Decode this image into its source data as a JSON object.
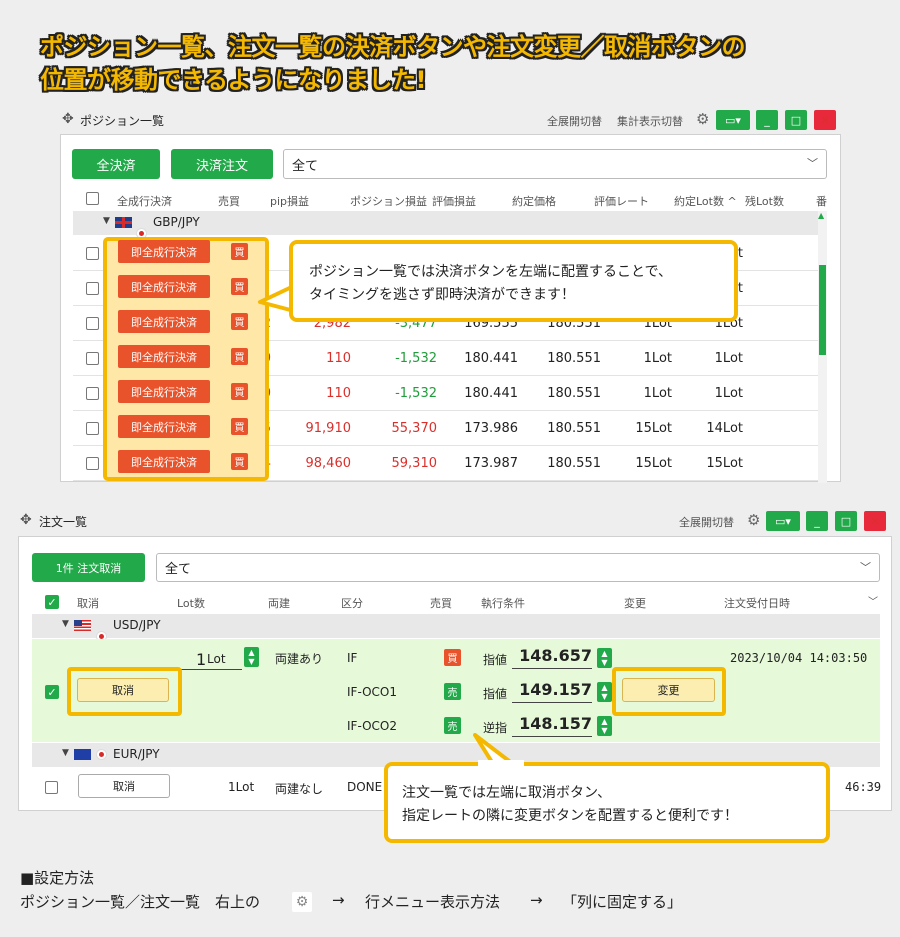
{
  "headline": {
    "line1": "ポジション一覧、注文一覧の決済ボタンや注文変更／取消ボタンの",
    "line2": "位置が移動できるようになりました!"
  },
  "position_panel": {
    "title": "ポジション一覧",
    "toolbar": {
      "expand": "全展開切替",
      "summary": "集計表示切替"
    },
    "buttons": {
      "close_all": "全決済",
      "close_order": "決済注文"
    },
    "filter": "全て",
    "headers": [
      "全成行決済",
      "売買",
      "pip損益",
      "ポジション損益",
      "評価損益",
      "約定価格",
      "評価レート",
      "約定Lot数 ^",
      "残Lot数",
      "番"
    ],
    "group": "GBP/JPY",
    "rows": [
      {
        "action": "即全成行決済",
        "side": "買",
        "pip": "",
        "pnl": "",
        "eval": "",
        "price": "",
        "rate": "",
        "lot": "",
        "remain": "1Lot"
      },
      {
        "action": "即全成行決済",
        "side": "買",
        "pip": "",
        "pnl": "",
        "eval": "",
        "price": "",
        "rate": "",
        "lot": "",
        "remain": "1Lot"
      },
      {
        "action": "即全成行決済",
        "side": "買",
        "pip": "2,982",
        "pnl": "2,982",
        "eval": "-3,477",
        "price": "169.555",
        "rate": "180.551",
        "lot": "1Lot",
        "remain": "1Lot"
      },
      {
        "action": "即全成行決済",
        "side": "買",
        "pip": "110",
        "pnl": "110",
        "eval": "-1,532",
        "price": "180.441",
        "rate": "180.551",
        "lot": "1Lot",
        "remain": "1Lot"
      },
      {
        "action": "即全成行決済",
        "side": "買",
        "pip": "110",
        "pnl": "110",
        "eval": "-1,532",
        "price": "180.441",
        "rate": "180.551",
        "lot": "1Lot",
        "remain": "1Lot"
      },
      {
        "action": "即全成行決済",
        "side": "買",
        "pip": "6,565",
        "pnl": "91,910",
        "eval": "55,370",
        "price": "173.986",
        "rate": "180.551",
        "lot": "15Lot",
        "remain": "14Lot"
      },
      {
        "action": "即全成行決済",
        "side": "買",
        "pip": "6,564",
        "pnl": "98,460",
        "eval": "59,310",
        "price": "173.987",
        "rate": "180.551",
        "lot": "15Lot",
        "remain": "15Lot"
      }
    ],
    "callout": {
      "line1": "ポジション一覧では決済ボタンを左端に配置することで、",
      "line2": "タイミングを逃さず即時決済ができます！"
    }
  },
  "order_panel": {
    "title": "注文一覧",
    "toolbar": {
      "expand": "全展開切替"
    },
    "buttons": {
      "cancel_selected": "1件 注文取消"
    },
    "filter": "全て",
    "headers": [
      "取消",
      "Lot数",
      "両建",
      "区分",
      "売買",
      "執行条件",
      "変更",
      "注文受付日時"
    ],
    "group1": "USD/JPY",
    "order": {
      "cancel": "取消",
      "lot_value": "1",
      "lot_unit": "Lot",
      "hedge": "両建あり",
      "change": "変更",
      "datetime": "2023/10/04 14:03:50",
      "legs": [
        {
          "type": "IF",
          "side": "買",
          "cond": "指値",
          "price": "148.657"
        },
        {
          "type": "IF-OCO1",
          "side": "売",
          "cond": "指値",
          "price": "149.157"
        },
        {
          "type": "IF-OCO2",
          "side": "売",
          "cond": "逆指",
          "price": "148.157"
        }
      ]
    },
    "group2": "EUR/JPY",
    "order2": {
      "cancel": "取消",
      "lot": "1Lot",
      "hedge": "両建なし",
      "type": "DONE",
      "datetime_tail": "46:39"
    },
    "callout": {
      "line1": "注文一覧では左端に取消ボタン、",
      "line2": "指定レートの隣に変更ボタンを配置すると便利です！"
    }
  },
  "setup": {
    "heading": "■設定方法",
    "step1": "ポジション一覧／注文一覧　右上の",
    "arrow1": "→",
    "step2": "行メニュー表示方法",
    "arrow2": "→",
    "step3": "「列に固定する」"
  },
  "colors": {
    "accent_green": "#22a94a",
    "order_orange": "#e9532b",
    "highlight_yellow": "#f5b800",
    "row_green": "#e6f9d9"
  }
}
